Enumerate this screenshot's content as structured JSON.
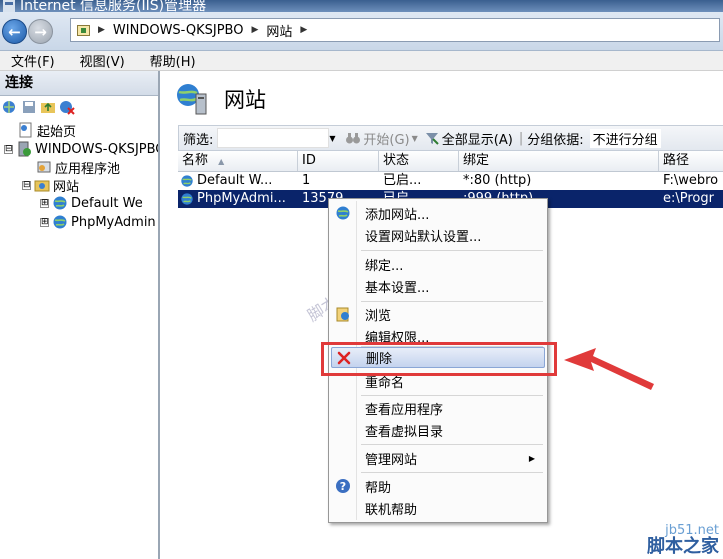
{
  "window": {
    "title": "Internet 信息服务(IIS)管理器"
  },
  "address": {
    "segments": [
      "WINDOWS-QKSJPBO",
      "网站"
    ]
  },
  "menubar": {
    "items": [
      "文件(F)",
      "视图(V)",
      "帮助(H)"
    ]
  },
  "left_pane": {
    "header": "连接",
    "tree": [
      {
        "label": "起始页",
        "icon": "start-page-icon"
      },
      {
        "label": "WINDOWS-QKSJPBO",
        "icon": "server-icon",
        "expander": "⊟"
      },
      {
        "label": "应用程序池",
        "icon": "app-pool-icon"
      },
      {
        "label": "网站",
        "icon": "sites-folder-icon",
        "expander": "⊟"
      },
      {
        "label": "Default We",
        "icon": "globe-icon",
        "expander": "⊞"
      },
      {
        "label": "PhpMyAdmin",
        "icon": "globe-icon",
        "expander": "⊞"
      }
    ]
  },
  "right_pane": {
    "title": "网站",
    "filter": {
      "label": "筛选:",
      "start": "开始(G)",
      "show_all": "全部显示(A)",
      "group_by": "分组依据:",
      "group_value": "不进行分组"
    },
    "columns": [
      "名称",
      "ID",
      "状态",
      "绑定",
      "路径"
    ],
    "rows": [
      {
        "name": "Default W...",
        "id": "1",
        "status": "已启...",
        "binding": "*:80 (http)",
        "path": "F:\\webro"
      },
      {
        "name": "PhpMyAdmi...",
        "id": "13579",
        "status": "已启...",
        "binding": ":999 (http)",
        "path": "e:\\Progr"
      }
    ]
  },
  "context_menu": {
    "items": [
      {
        "label": "添加网站...",
        "icon": "globe-add-icon"
      },
      {
        "label": "设置网站默认设置..."
      },
      {
        "sep": true
      },
      {
        "label": "绑定..."
      },
      {
        "label": "基本设置..."
      },
      {
        "sep": true
      },
      {
        "label": "浏览",
        "icon": "browse-icon"
      },
      {
        "label": "编辑权限..."
      },
      {
        "sep": true
      },
      {
        "label": "删除",
        "icon": "delete-x-icon",
        "highlight": true
      },
      {
        "label": "重命名"
      },
      {
        "sep": true
      },
      {
        "label": "查看应用程序"
      },
      {
        "label": "查看虚拟目录"
      },
      {
        "sep": true
      },
      {
        "label": "管理网站",
        "submenu": true
      },
      {
        "sep": true
      },
      {
        "label": "帮助",
        "icon": "help-icon"
      },
      {
        "label": "联机帮助"
      }
    ]
  },
  "watermarks": {
    "center": "脚本之家 jb51.net",
    "corner_top": "jb51.net",
    "corner_bottom": "脚本之家"
  },
  "colors": {
    "selection": "#0a246a",
    "annotation": "#e03a3a",
    "menu_highlight": "#c4d3ee"
  }
}
